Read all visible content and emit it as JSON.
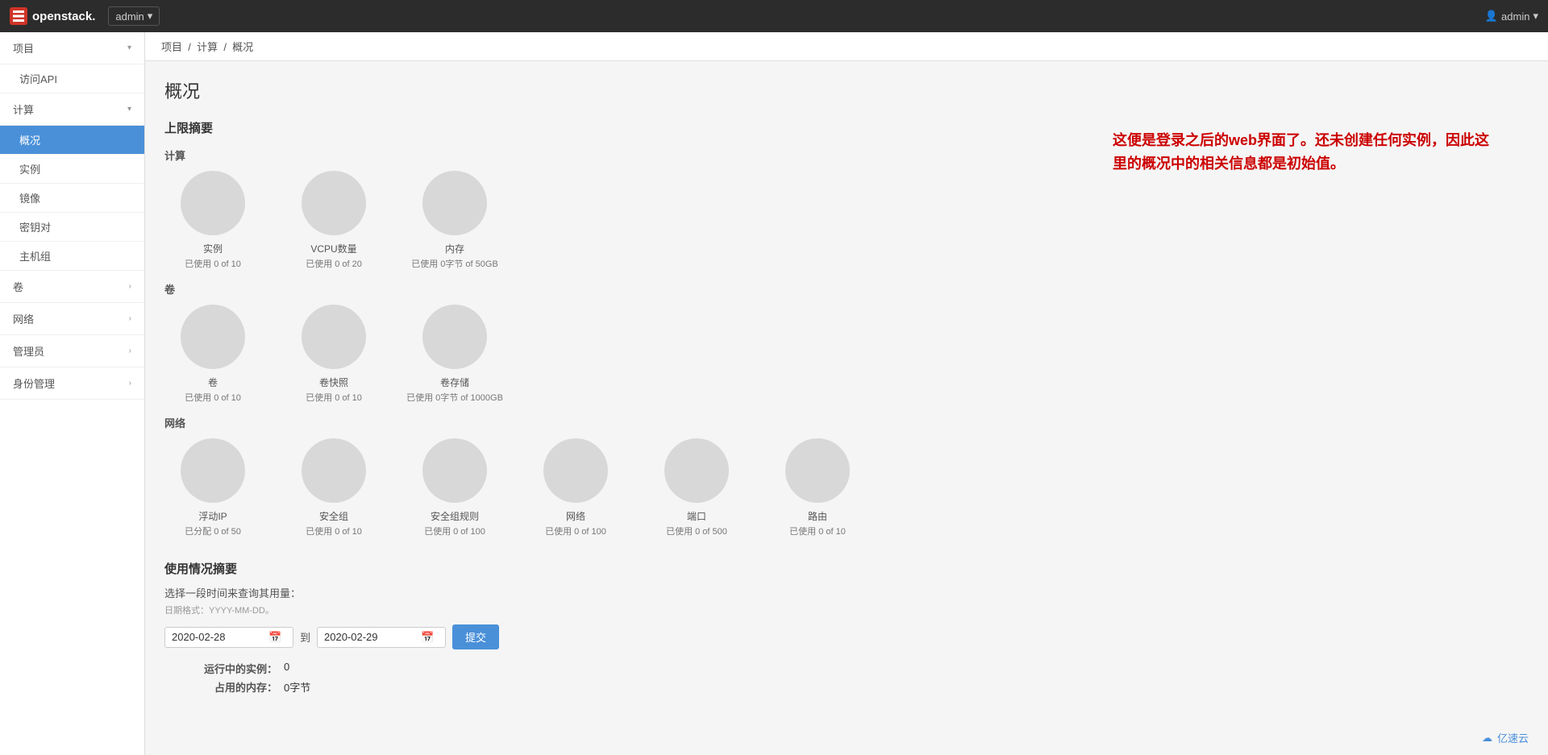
{
  "topbar": {
    "logo_text": "openstack.",
    "admin_label": "admin",
    "admin_dropdown": "▾",
    "user_label": "admin",
    "user_dropdown": "▾"
  },
  "breadcrumb": {
    "project": "项目",
    "compute": "计算",
    "overview": "概况"
  },
  "page_title": "概况",
  "limit_summary": {
    "title": "上限摘要",
    "compute_section": "计算",
    "volumes_section": "卷",
    "network_section": "网络",
    "compute_items": [
      {
        "label": "实例",
        "value": "已使用 0 of 10"
      },
      {
        "label": "VCPU数量",
        "value": "已使用 0 of 20"
      },
      {
        "label": "内存",
        "value": "已使用 0字节 of 50GB"
      }
    ],
    "volume_items": [
      {
        "label": "卷",
        "value": "已使用 0 of 10"
      },
      {
        "label": "卷快照",
        "value": "已使用 0 of 10"
      },
      {
        "label": "卷存储",
        "value": "已使用 0字节 of 1000GB"
      }
    ],
    "network_items": [
      {
        "label": "浮动IP",
        "value": "已分配 0 of 50"
      },
      {
        "label": "安全组",
        "value": "已使用 0 of 10"
      },
      {
        "label": "安全组规则",
        "value": "已使用 0 of 100"
      },
      {
        "label": "网络",
        "value": "已使用 0 of 100"
      },
      {
        "label": "端口",
        "value": "已使用 0 of 500"
      },
      {
        "label": "路由",
        "value": "已使用 0 of 10"
      }
    ]
  },
  "usage_summary": {
    "title": "使用情况摘要",
    "query_label": "选择一段时间来查询其用量：",
    "date_format_hint": "日期格式：YYYY-MM-DD。",
    "start_date": "2020-02-28",
    "end_date": "2020-02-29",
    "sep_label": "到",
    "submit_label": "提交",
    "running_instances_label": "运行中的实例：",
    "running_instances_value": "0",
    "used_memory_label": "占用的内存：",
    "used_memory_value": "0字节"
  },
  "sidebar": {
    "project_label": "项目",
    "visit_api_label": "访问API",
    "compute_label": "计算",
    "overview_label": "概况",
    "instances_label": "实例",
    "images_label": "镜像",
    "keypairs_label": "密钥对",
    "hostgroups_label": "主机组",
    "volumes_label": "卷",
    "network_label": "网络",
    "admin_label": "管理员",
    "identity_label": "身份管理"
  },
  "annotation": "这便是登录之后的web界面了。还未创建任何实例，因此这里的概况中的相关信息都是初始值。",
  "brand": "亿速云"
}
